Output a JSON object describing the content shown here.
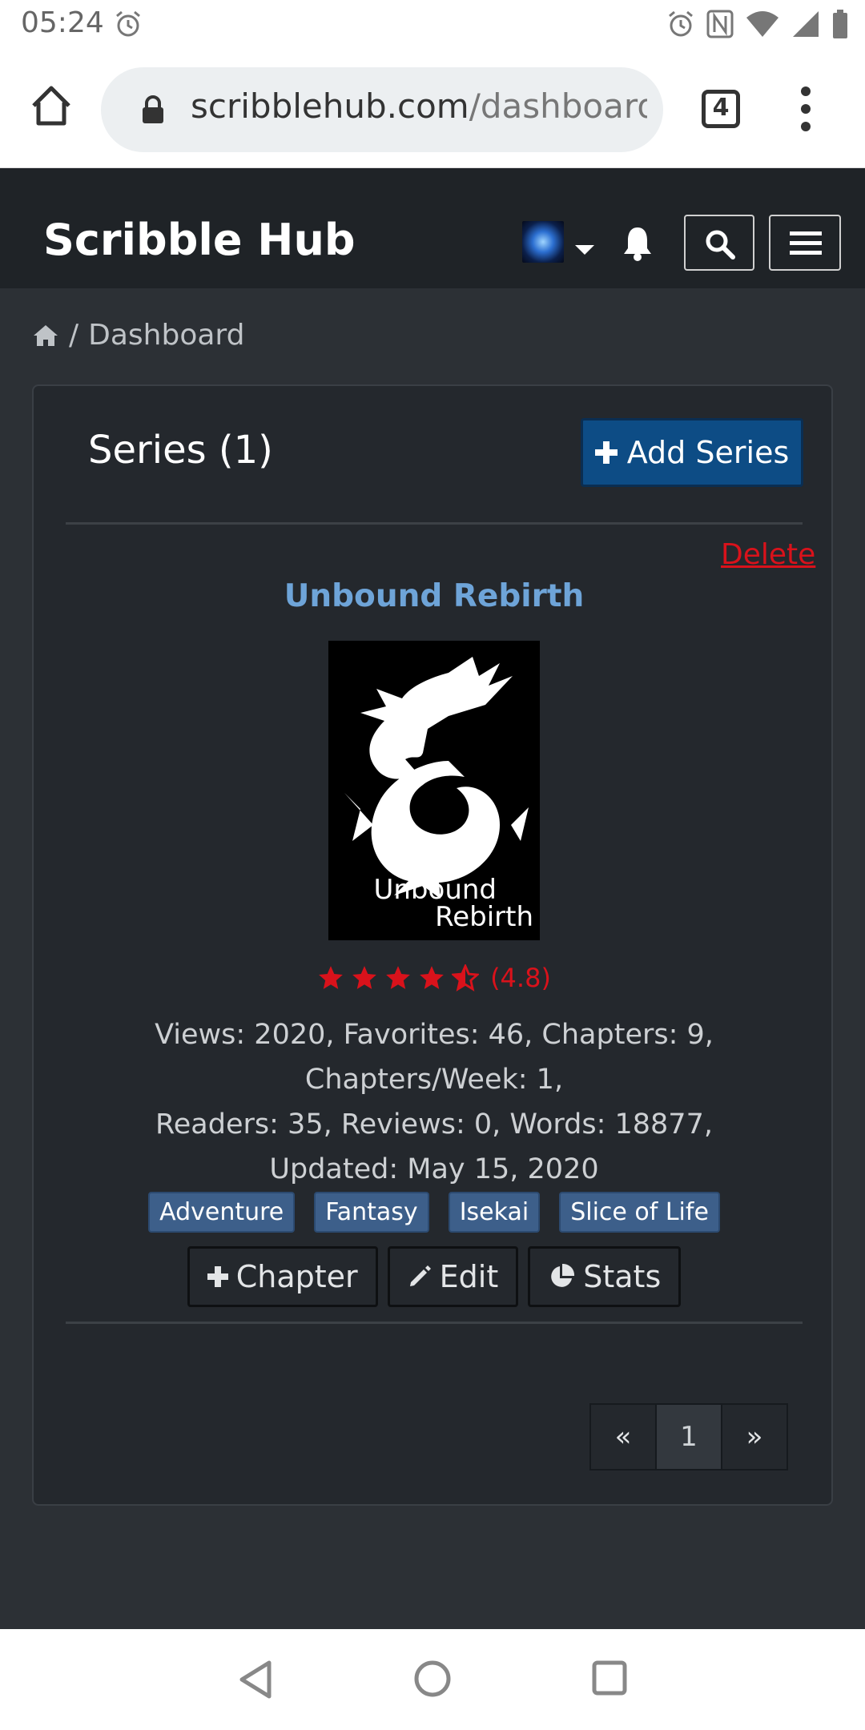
{
  "status_bar": {
    "time": "05:24",
    "icons": [
      "alarm-icon",
      "alarm-icon",
      "nfc-icon",
      "wifi-icon",
      "signal-icon",
      "battery-icon"
    ]
  },
  "browser": {
    "url_host": "scribblehub.com",
    "url_path": "/dashboard/",
    "tab_count": "4"
  },
  "site": {
    "brand": "Scribble Hub"
  },
  "breadcrumb": {
    "current": "Dashboard",
    "separator": "/"
  },
  "card": {
    "title": "Series (1)",
    "add_series_label": "Add Series"
  },
  "series": {
    "delete_label": "Delete",
    "title": "Unbound Rebirth",
    "cover_text_line1": "Unbound",
    "cover_text_line2": "Rebirth",
    "rating_text": "(4.8)",
    "rating_value": 4.8,
    "rating_max": 5,
    "stats_line1": "Views: 2020, Favorites: 46, Chapters: 9, Chapters/Week: 1,",
    "stats_line2": "Readers: 35, Reviews: 0, Words: 18877,",
    "stats_line3": "Updated: May 15, 2020",
    "tags": [
      "Adventure",
      "Fantasy",
      "Isekai",
      "Slice of Life"
    ],
    "actions": {
      "chapter": "Chapter",
      "edit": "Edit",
      "stats": "Stats"
    }
  },
  "pagination": {
    "prev": "«",
    "page": "1",
    "next": "»"
  },
  "colors": {
    "header_bg": "#1f2327",
    "page_bg": "#2c3035",
    "card_bg": "#24282d",
    "accent_blue": "#0d4c85",
    "title_blue": "#6ea4d8",
    "delete_red": "#d9121b",
    "tag_bg": "#3d5f8a"
  }
}
